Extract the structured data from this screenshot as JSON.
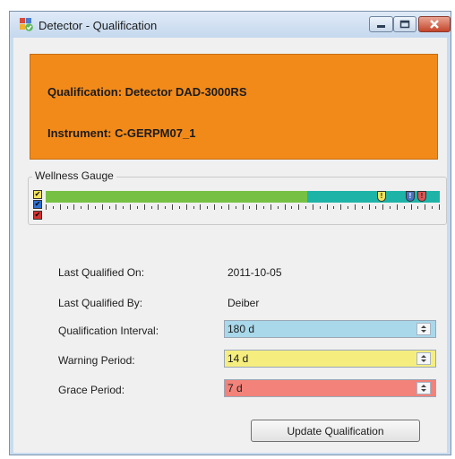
{
  "window": {
    "title": "Detector - Qualification",
    "controls": [
      "minimize-icon",
      "maximize-icon",
      "close-icon"
    ]
  },
  "banner": {
    "qualification": "Qualification: Detector DAD-3000RS",
    "instrument": "Instrument: C-GERPM07_1",
    "color": "#f28a1a"
  },
  "wellness": {
    "label": "Wellness Gauge",
    "ok_fraction": 0.664,
    "markers": [
      {
        "icon": "warning-marker-icon",
        "glyph": "!",
        "color": "#f3e35a",
        "position": 0.853
      },
      {
        "icon": "info-marker-icon",
        "glyph": "!",
        "color": "#4a72c0",
        "position": 0.925
      },
      {
        "icon": "error-marker-icon",
        "glyph": "!",
        "color": "#e05454",
        "position": 0.954
      }
    ],
    "legend": [
      {
        "icon": "yellow-check-icon",
        "color": "#f3e35a"
      },
      {
        "icon": "blue-check-icon",
        "color": "#2f6fd0"
      },
      {
        "icon": "red-check-icon",
        "color": "#d43030"
      }
    ],
    "colors": {
      "ok": "#76c043",
      "warning": "#1eb3a7"
    }
  },
  "fields": {
    "last_qualified_on": {
      "label": "Last Qualified On:",
      "value": "2011-10-05"
    },
    "last_qualified_by": {
      "label": "Last Qualified By:",
      "value": "Deiber"
    },
    "interval": {
      "label": "Qualification Interval:",
      "value": "180 d",
      "color": "#a8d8ea"
    },
    "warning": {
      "label": "Warning Period:",
      "value": "14 d",
      "color": "#f5ee7f"
    },
    "grace": {
      "label": "Grace Period:",
      "value": "7 d",
      "color": "#f2827a"
    }
  },
  "actions": {
    "update_label": "Update Qualification"
  }
}
